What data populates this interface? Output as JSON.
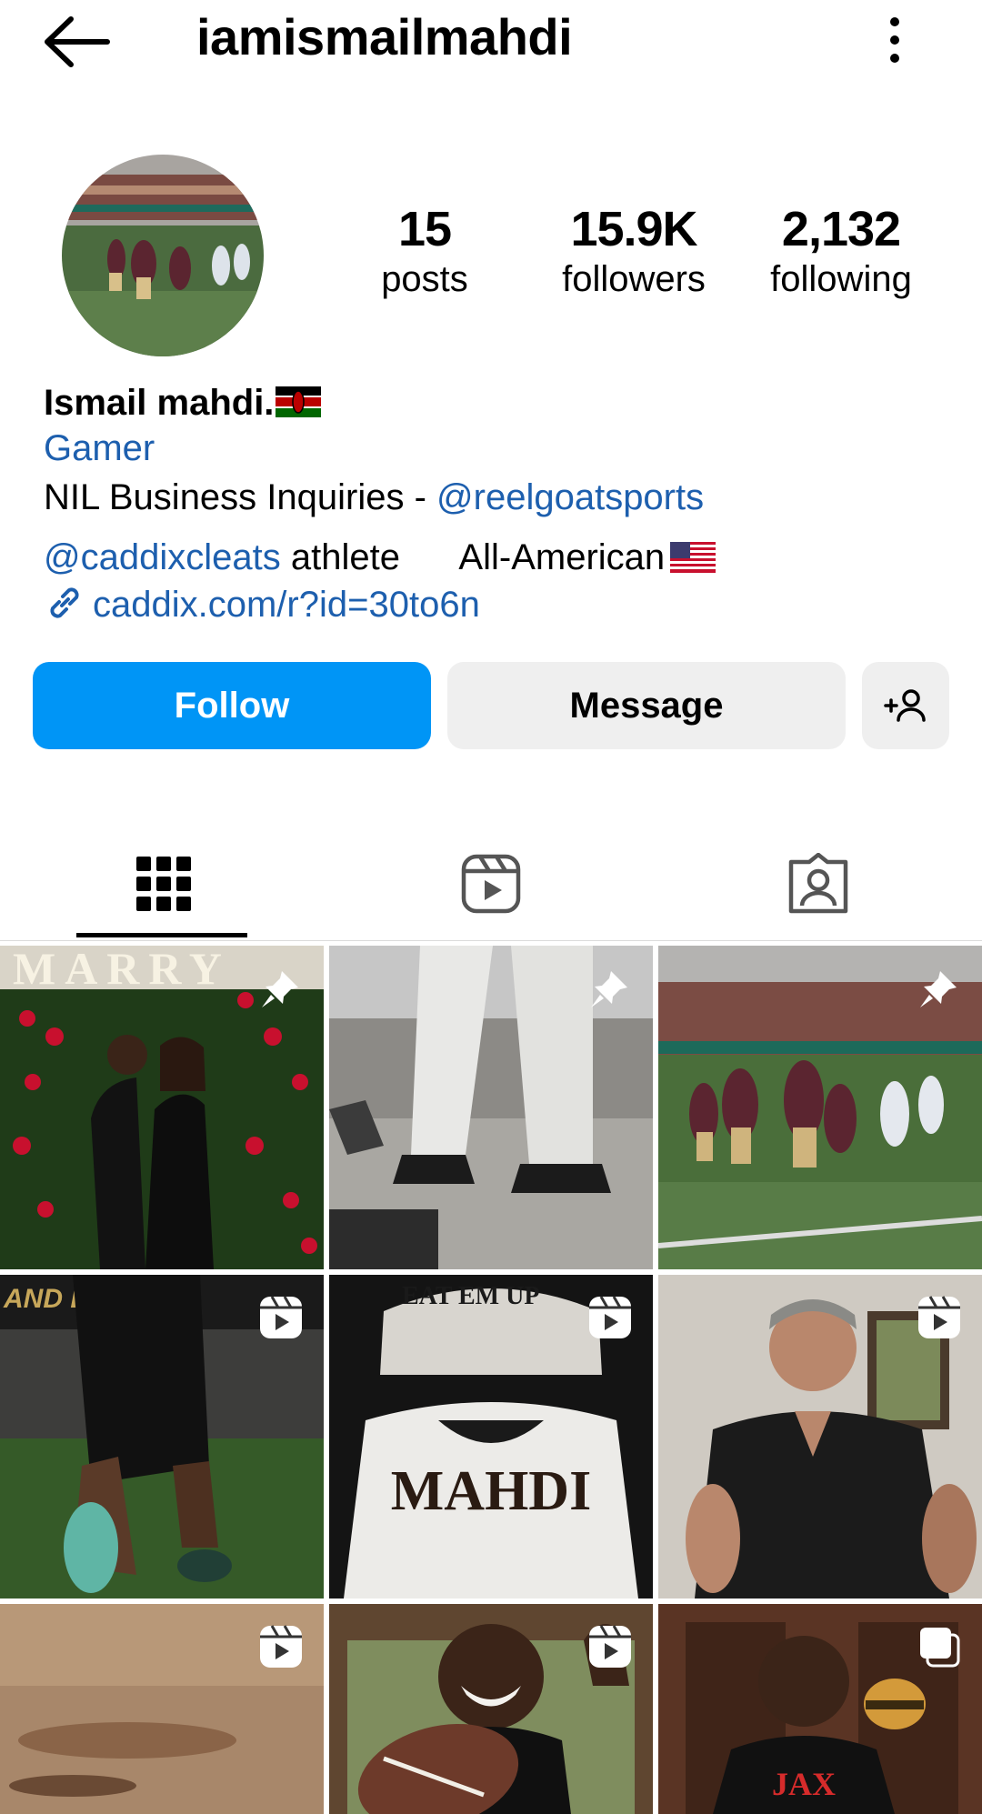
{
  "header": {
    "username": "iamismailmahdi",
    "back_icon": "arrow-left-icon",
    "more_icon": "more-vertical-icon"
  },
  "stats": [
    {
      "value": "15",
      "label": "posts"
    },
    {
      "value": "15.9K",
      "label": "followers"
    },
    {
      "value": "2,132",
      "label": "following"
    }
  ],
  "bio": {
    "name": "Ismail mahdi.",
    "category": "Gamer",
    "line1_text": "NIL Business Inquiries - ",
    "line1_mention": "@reelgoatsports",
    "line2_mention": "@caddixcleats",
    "line2_text": " athlete      All-American",
    "link": "caddix.com/r?id=30to6n"
  },
  "actions": {
    "follow": "Follow",
    "message": "Message",
    "add_user_icon": "add-person-icon"
  },
  "tabs": [
    {
      "name": "posts",
      "icon": "grid-icon",
      "active": true
    },
    {
      "name": "reels",
      "icon": "reels-icon",
      "active": false
    },
    {
      "name": "tagged",
      "icon": "tagged-person-icon",
      "active": false
    }
  ],
  "grid": {
    "posts": [
      {
        "kind": "pinned",
        "banner_text": "MARRY",
        "subject": "couple"
      },
      {
        "kind": "pinned",
        "subject": "cleats"
      },
      {
        "kind": "pinned",
        "subject": "football-game"
      },
      {
        "kind": "reel",
        "banner_text": "AND E",
        "subject": "cleat-kick"
      },
      {
        "kind": "reel",
        "helmet_text": "EAT EM UP",
        "jersey_text": "MAHDI"
      },
      {
        "kind": "reel",
        "subject": "doctor"
      },
      {
        "kind": "reel",
        "subject": "field-dirt"
      },
      {
        "kind": "reel",
        "subject": "football-smile"
      },
      {
        "kind": "carousel",
        "shirt_text": "JAX",
        "subject": "burger"
      }
    ]
  },
  "colors": {
    "primary": "#0095f6",
    "link": "#1d5fae",
    "button_bg": "#efefef"
  }
}
